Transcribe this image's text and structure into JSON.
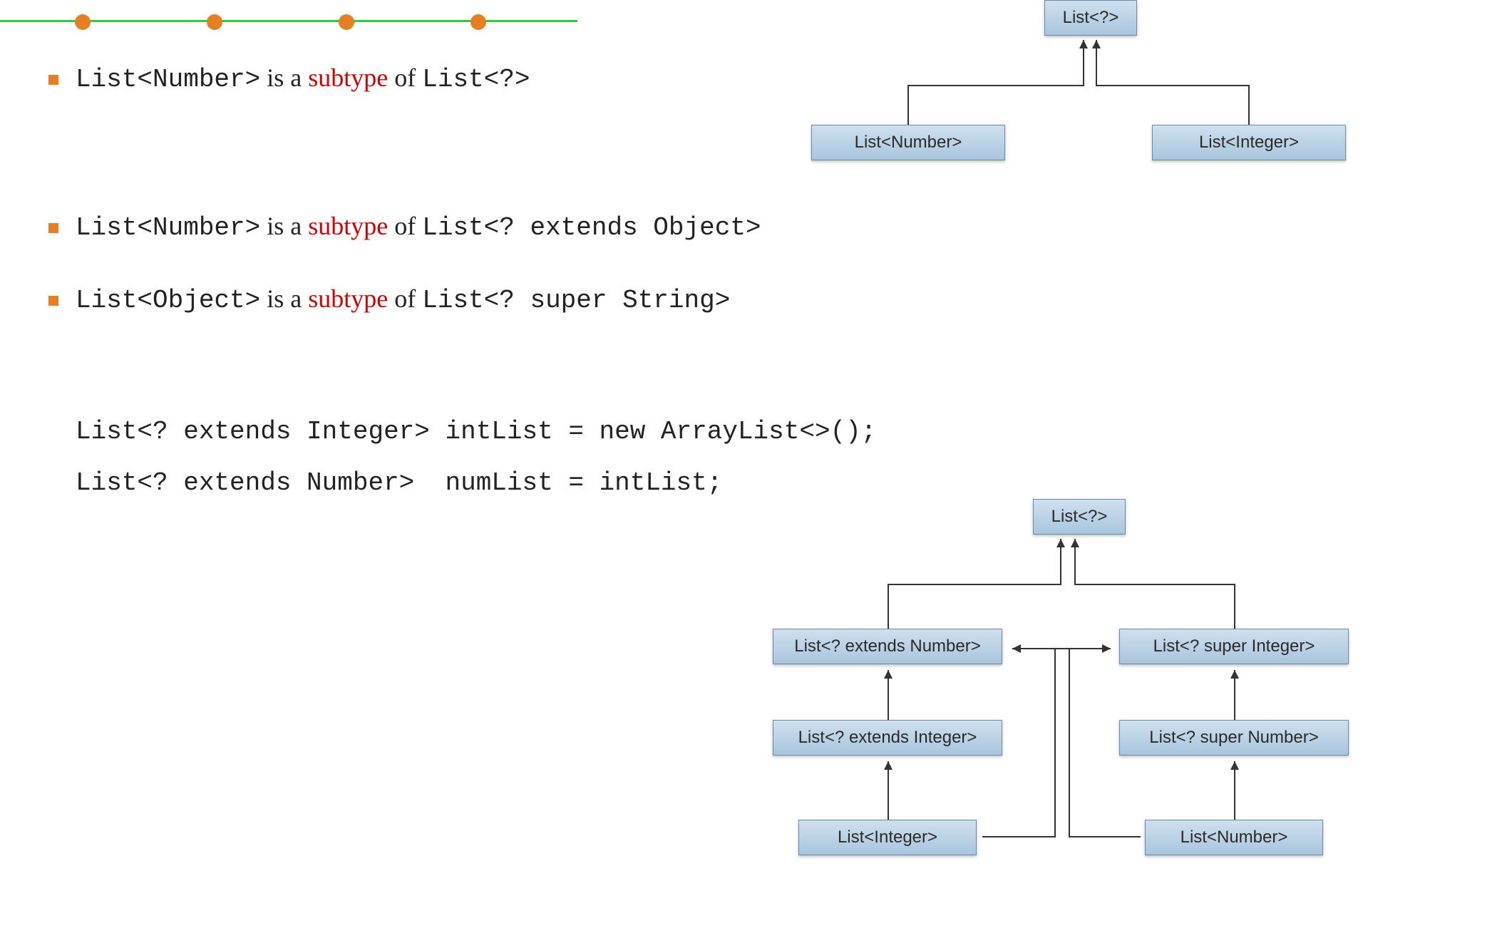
{
  "bullets": {
    "b1": {
      "p1": "List<Number>",
      "p2": " is a ",
      "p3": "subtype",
      "p4": " of ",
      "p5": "List<?>"
    },
    "b2": {
      "p1": "List<Number>",
      "p2": " is a ",
      "p3": "subtype",
      "p4": " of ",
      "p5": "List<? extends Object>"
    },
    "b3": {
      "p1": "List<Object>",
      "p2": " is a ",
      "p3": "subtype",
      "p4": " of ",
      "p5": "List<? super String>"
    }
  },
  "code": {
    "line1": "List<? extends Integer> intList = new ArrayList<>();",
    "line2": "List<? extends Number>  numList = intList;"
  },
  "diagram1": {
    "top": "List<?>",
    "left": "List<Number>",
    "right": "List<Integer>"
  },
  "diagram2": {
    "top": "List<?>",
    "l1": "List<? extends Number>",
    "l2": "List<? extends Integer>",
    "l3": "List<Integer>",
    "r1": "List<? super Integer>",
    "r2": "List<? super Number>",
    "r3": "List<Number>"
  }
}
